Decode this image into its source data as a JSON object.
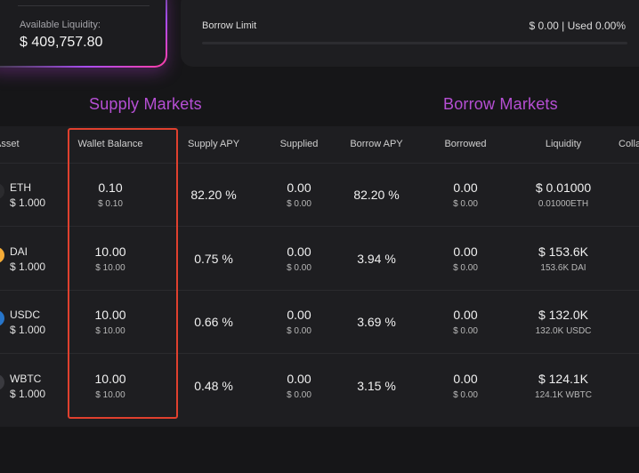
{
  "liquidity": {
    "label": "Available Liquidity:",
    "value": "$ 409,757.80"
  },
  "borrow_limit": {
    "label": "Borrow Limit",
    "value": "$ 0.00 | Used 0.00%"
  },
  "markets": {
    "supply_title": "Supply Markets",
    "borrow_title": "Borrow Markets"
  },
  "table": {
    "headers": {
      "asset": "Asset",
      "wallet_balance": "Wallet Balance",
      "supply_apy": "Supply APY",
      "supplied": "Supplied",
      "borrow_apy": "Borrow APY",
      "borrowed": "Borrowed",
      "liquidity": "Liquidity",
      "collateral": "Collateral"
    },
    "rows": [
      {
        "name": "ETH",
        "price": "$ 1.000",
        "icon": "eth-icon",
        "icon_color": "#2b2b2e",
        "wallet": "0.10",
        "wallet_usd": "$ 0.10",
        "supply_apy": "82.20 %",
        "supplied": "0.00",
        "supplied_usd": "$ 0.00",
        "borrow_apy": "82.20 %",
        "borrowed": "0.00",
        "borrowed_usd": "$ 0.00",
        "liquidity": "$ 0.01000",
        "liquidity_sub": "0.01000ETH"
      },
      {
        "name": "DAI",
        "price": "$ 1.000",
        "icon": "dai-icon",
        "icon_color": "#f5ac37",
        "wallet": "10.00",
        "wallet_usd": "$ 10.00",
        "supply_apy": "0.75 %",
        "supplied": "0.00",
        "supplied_usd": "$ 0.00",
        "borrow_apy": "3.94 %",
        "borrowed": "0.00",
        "borrowed_usd": "$ 0.00",
        "liquidity": "$ 153.6K",
        "liquidity_sub": "153.6K DAI"
      },
      {
        "name": "USDC",
        "price": "$ 1.000",
        "icon": "usdc-icon",
        "icon_color": "#2775ca",
        "wallet": "10.00",
        "wallet_usd": "$ 10.00",
        "supply_apy": "0.66 %",
        "supplied": "0.00",
        "supplied_usd": "$ 0.00",
        "borrow_apy": "3.69 %",
        "borrowed": "0.00",
        "borrowed_usd": "$ 0.00",
        "liquidity": "$ 132.0K",
        "liquidity_sub": "132.0K USDC"
      },
      {
        "name": "WBTC",
        "price": "$ 1.000",
        "icon": "wbtc-icon",
        "icon_color": "#3a3a3f",
        "wallet": "10.00",
        "wallet_usd": "$ 10.00",
        "supply_apy": "0.48 %",
        "supplied": "0.00",
        "supplied_usd": "$ 0.00",
        "borrow_apy": "3.15 %",
        "borrowed": "0.00",
        "borrowed_usd": "$ 0.00",
        "liquidity": "$ 124.1K",
        "liquidity_sub": "124.1K WBTC"
      }
    ]
  },
  "highlight_color": "#e0402e"
}
